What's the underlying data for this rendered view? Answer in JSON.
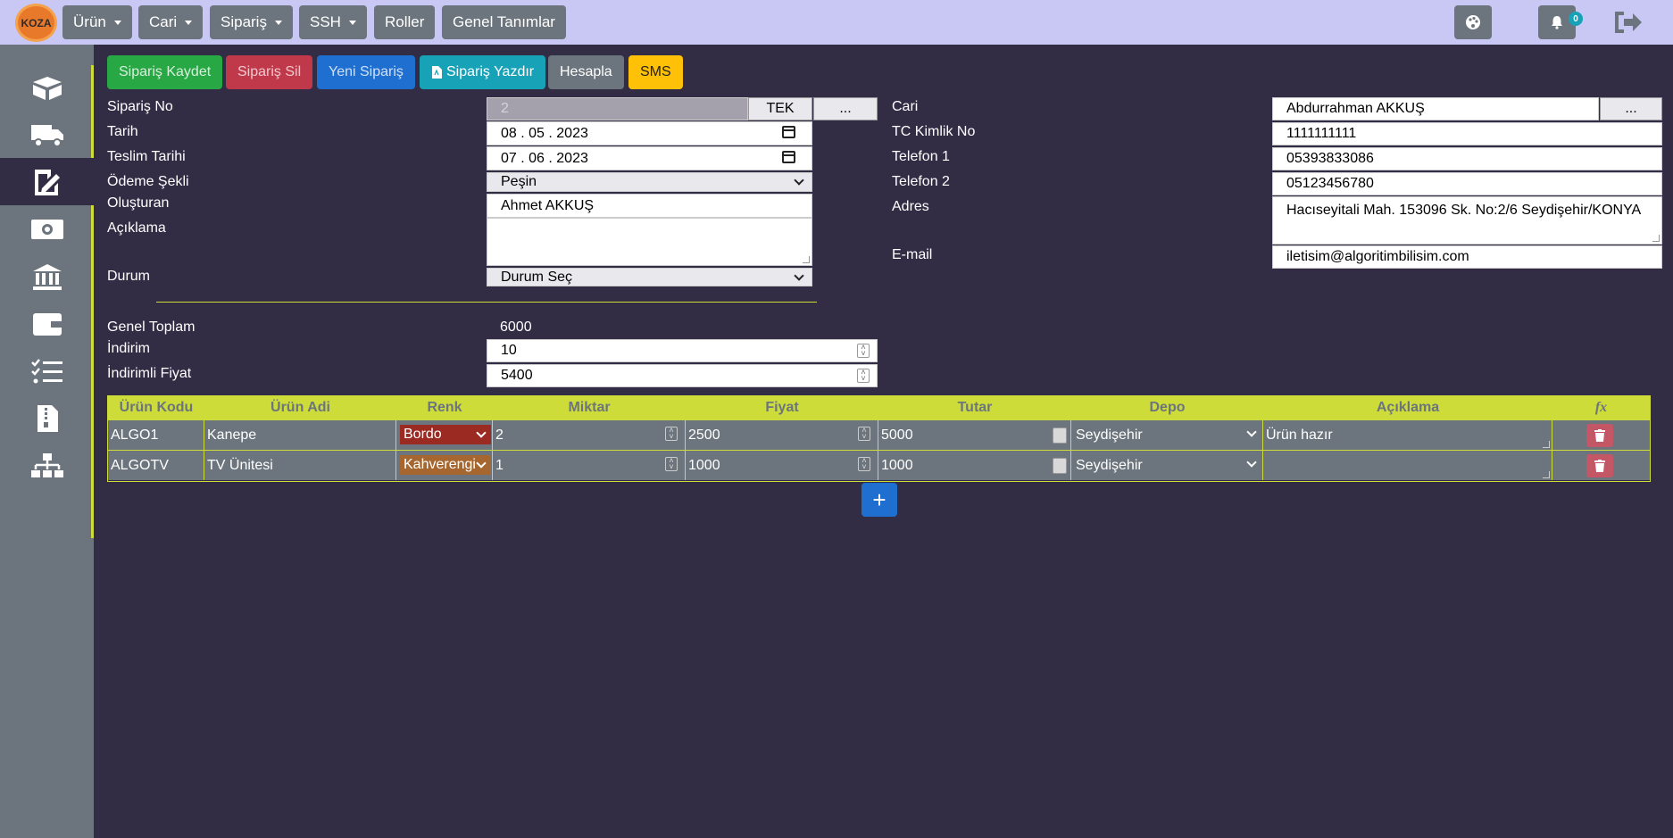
{
  "nav": {
    "logo": "KOZA",
    "menus": [
      "Ürün",
      "Cari",
      "Sipariş",
      "SSH"
    ],
    "roller": "Roller",
    "genel": "Genel Tanımlar",
    "notif_count": "0"
  },
  "actions": {
    "kaydet": "Sipariş Kaydet",
    "sil": "Sipariş Sil",
    "yeni": "Yeni Sipariş",
    "yazdir": "Sipariş Yazdır",
    "hesapla": "Hesapla",
    "sms": "SMS"
  },
  "colors": {
    "kaydet": "#28a745",
    "sil": "#c0394b",
    "yeni": "#1f6fd1",
    "yazdir": "#17a2b8",
    "hesapla": "#6c757d",
    "sms": "#ffc107",
    "accent": "#cddc39"
  },
  "order": {
    "siparis_no_label": "Sipariş No",
    "siparis_no": "2",
    "tek": "TEK",
    "dots": "...",
    "tarih_label": "Tarih",
    "tarih": "08 . 05 . 2023",
    "teslim_label": "Teslim Tarihi",
    "teslim": "07 . 06 . 2023",
    "odeme_label": "Ödeme Şekli",
    "odeme": "Peşin",
    "olusturan_label": "Oluşturan",
    "olusturan": "Ahmet AKKUŞ",
    "aciklama_label": "Açıklama",
    "aciklama": "",
    "durum_label": "Durum",
    "durum": "Durum Seç",
    "genel_toplam_label": "Genel Toplam",
    "genel_toplam": "6000",
    "indirim_label": "İndirim",
    "indirim": "10",
    "indirimli_label": "İndirimli Fiyat",
    "indirimli": "5400"
  },
  "customer": {
    "cari_label": "Cari",
    "cari": "Abdurrahman AKKUŞ",
    "dots": "...",
    "tc_label": "TC Kimlik No",
    "tc": "1111111111",
    "tel1_label": "Telefon 1",
    "tel1": "05393833086",
    "tel2_label": "Telefon 2",
    "tel2": "05123456780",
    "adres_label": "Adres",
    "adres": "Hacıseyitali Mah. 153096 Sk. No:2/6 Seydişehir/KONYA",
    "email_label": "E-mail",
    "email": "iletisim@algoritimbilisim.com"
  },
  "table": {
    "headers": [
      "Ürün Kodu",
      "Ürün Adi",
      "Renk",
      "Miktar",
      "Fiyat",
      "Tutar",
      "Depo",
      "Açıklama",
      "fx"
    ],
    "rows": [
      {
        "kod": "ALGO1",
        "ad": "Kanepe",
        "renk": "Bordo",
        "renk_color": "#9b2a23",
        "miktar": "2",
        "fiyat": "2500",
        "tutar": "5000",
        "depo": "Seydişehir",
        "aciklama": "Ürün hazır"
      },
      {
        "kod": "ALGOTV",
        "ad": "TV Ünitesi",
        "renk": "Kahverengi",
        "renk_color": "#a5672f",
        "miktar": "1",
        "fiyat": "1000",
        "tutar": "1000",
        "depo": "Seydişehir",
        "aciklama": ""
      }
    ]
  },
  "add_label": "+"
}
